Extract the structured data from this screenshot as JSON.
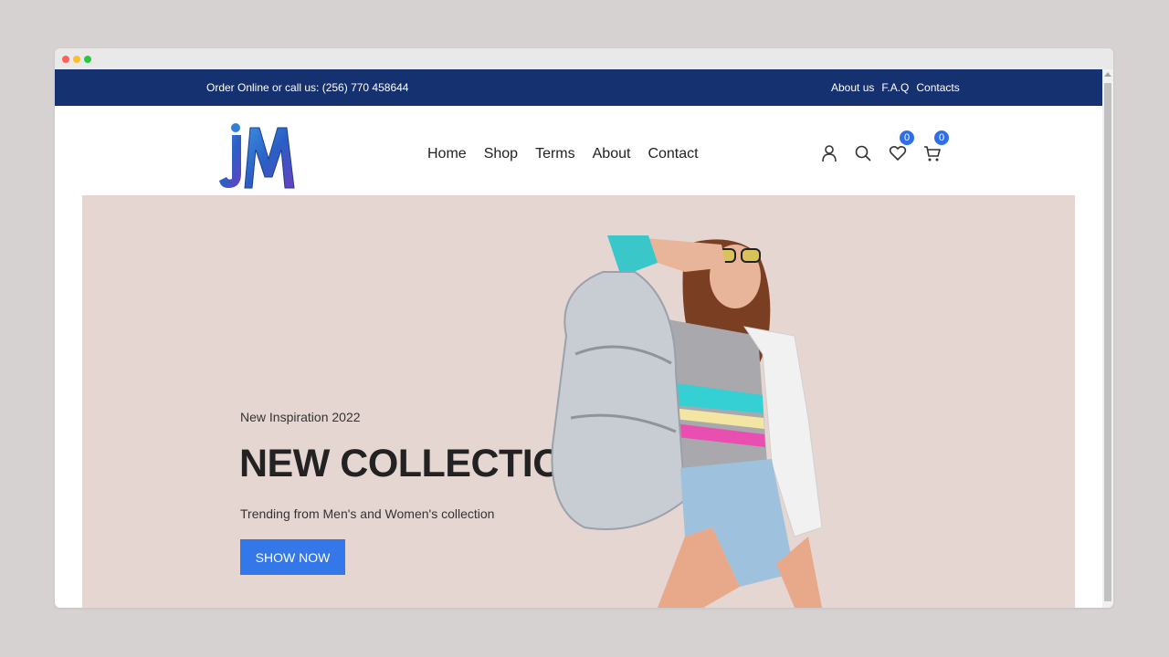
{
  "topbar": {
    "phone_text": "Order Online or call us: (256) 770 458644",
    "links": [
      "About us",
      "F.A.Q",
      "Contacts"
    ]
  },
  "header": {
    "logo_text": "JM",
    "nav": [
      "Home",
      "Shop",
      "Terms",
      "About",
      "Contact"
    ],
    "icons": [
      "user-icon",
      "search-icon",
      "heart-icon",
      "cart-icon"
    ],
    "wishlist_count": "0",
    "cart_count": "0"
  },
  "hero": {
    "kicker": "New Inspiration 2022",
    "headline": "NEW COLLECTION!",
    "subtitle": "Trending from Men's and Women's collection",
    "cta_label": "SHOW NOW"
  },
  "colors": {
    "topbar_bg": "#163170",
    "hero_bg": "#e6d6d2",
    "accent": "#3477e8",
    "badge": "#2f6ee8"
  }
}
